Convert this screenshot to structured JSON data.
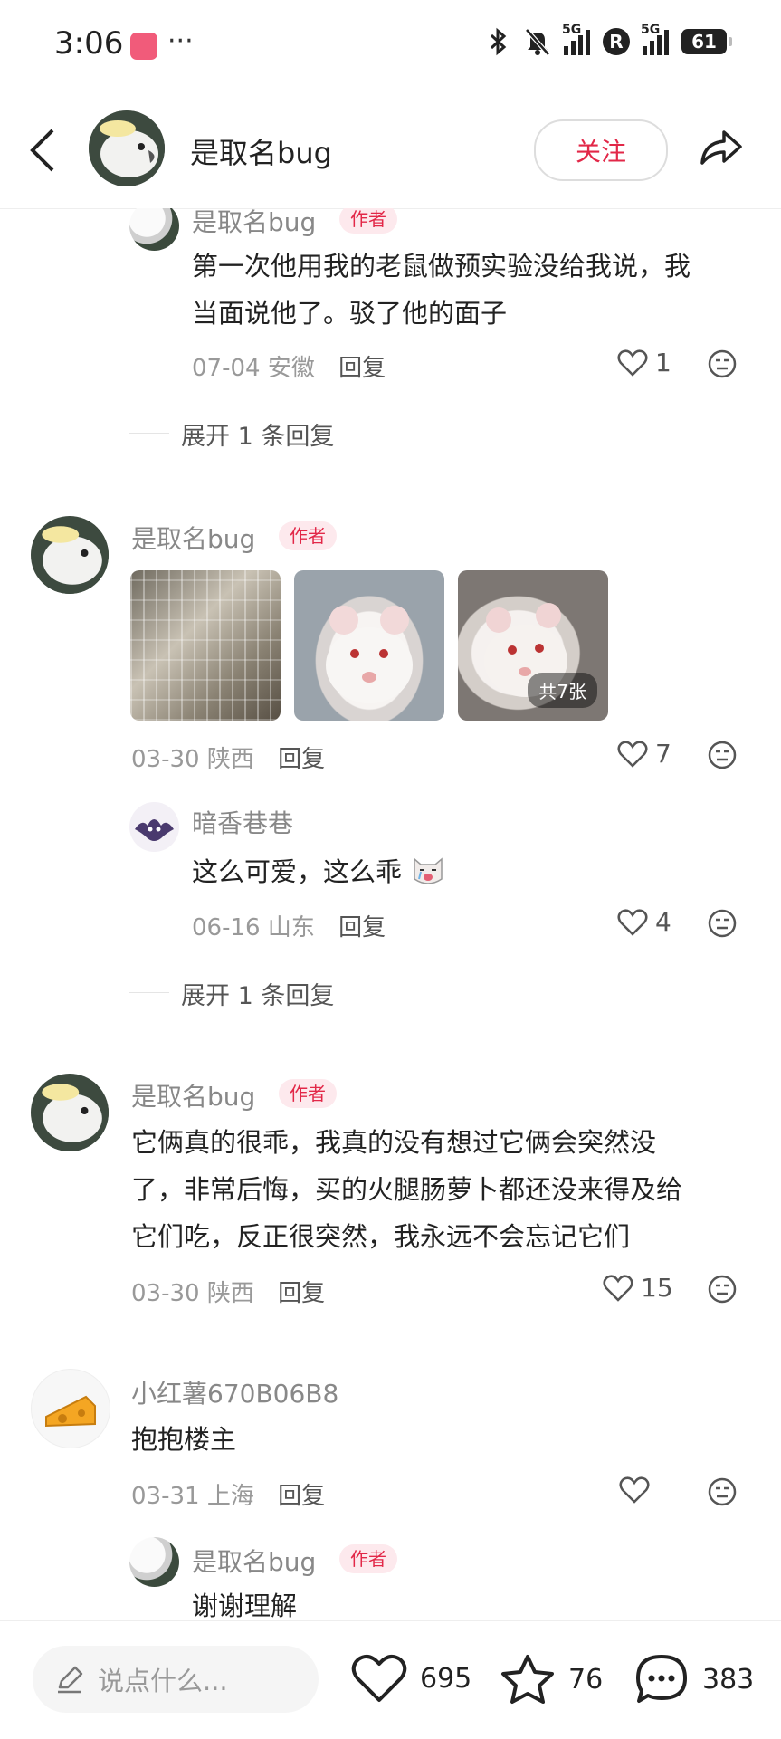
{
  "status_bar": {
    "time": "3:06",
    "more": "···",
    "network_1": "5G",
    "network_2": "5G",
    "r_badge": "R",
    "battery": "61"
  },
  "header": {
    "author_name": "是取名bug",
    "follow_label": "关注"
  },
  "author_tag": "作者",
  "comments": [
    {
      "user": "是取名bug",
      "text_lines": [
        "第一次他用我的老鼠做预实验没给我说，我",
        "当面说他了。驳了他的面子"
      ],
      "date": "07-04 安徽",
      "reply": "回复",
      "likes": "1"
    },
    {
      "expand": "展开 1 条回复"
    },
    {
      "user": "是取名bug",
      "photos_count": "共7张",
      "date": "03-30 陕西",
      "reply": "回复",
      "likes": "7"
    },
    {
      "user": "暗香巷巷",
      "text": "这么可爱，这么乖",
      "date": "06-16 山东",
      "reply": "回复",
      "likes": "4"
    },
    {
      "expand": "展开 1 条回复"
    },
    {
      "user": "是取名bug",
      "text_lines": [
        "它俩真的很乖，我真的没有想过它俩会突然没",
        "了，非常后悔，买的火腿肠萝卜都还没来得及给",
        "它们吃，反正很突然，我永远不会忘记它们"
      ],
      "date": "03-30 陕西",
      "reply": "回复",
      "likes": "15"
    },
    {
      "user": "小红薯670B06B8",
      "text": "抱抱楼主",
      "date": "03-31 上海",
      "reply": "回复",
      "likes": ""
    },
    {
      "user": "是取名bug",
      "text": "谢谢理解"
    }
  ],
  "bottom_bar": {
    "input_placeholder": "说点什么...",
    "likes": "695",
    "collects": "76",
    "comments": "383"
  },
  "colors": {
    "accent": "#e22848",
    "author_tag_bg": "#fde9ed"
  }
}
